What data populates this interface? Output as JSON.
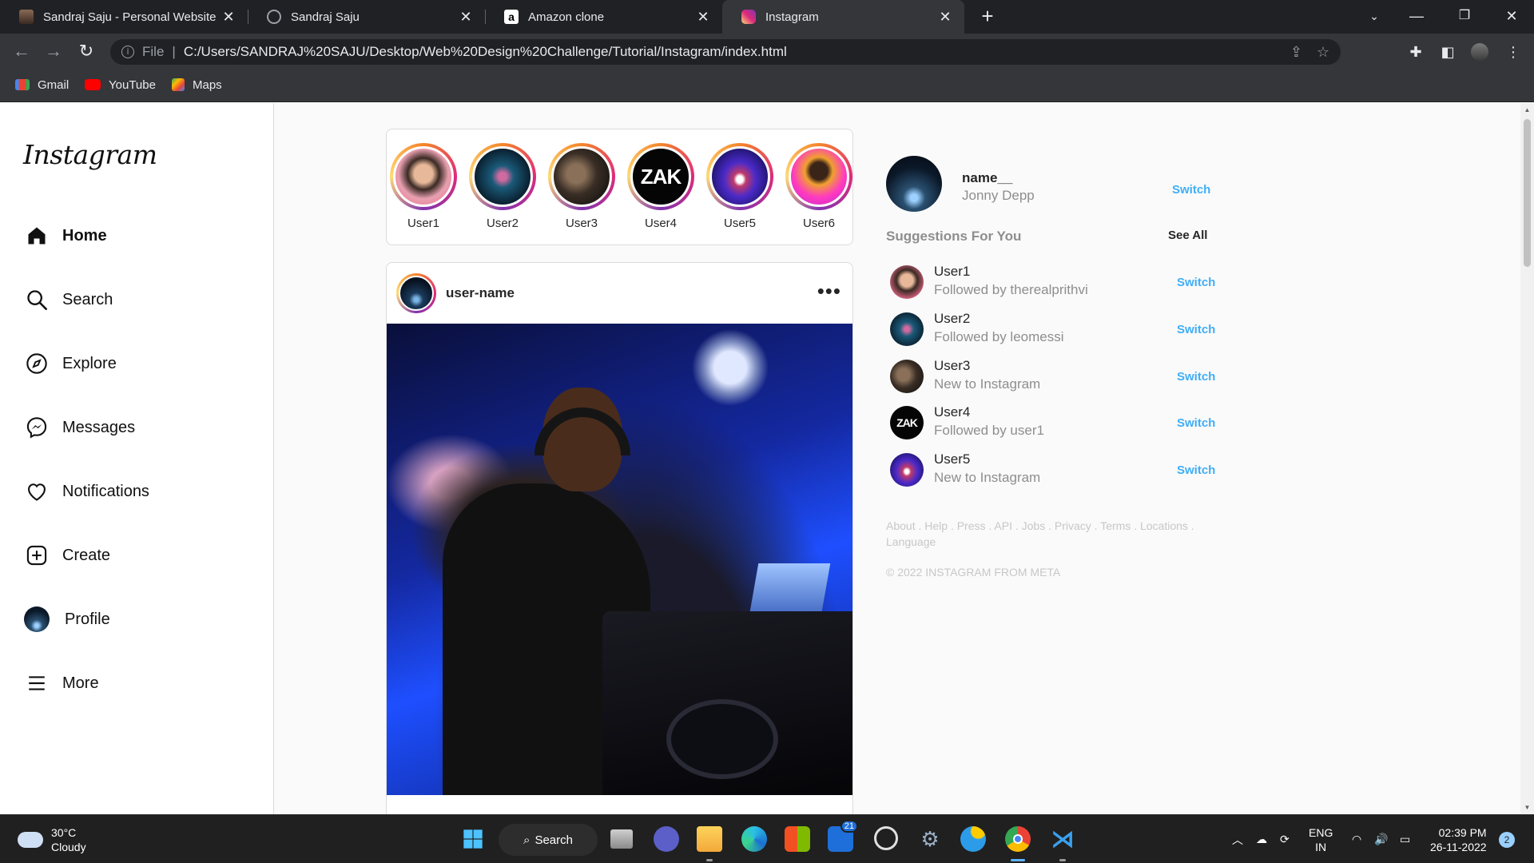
{
  "browser": {
    "tabs": [
      {
        "title": "Sandraj Saju - Personal Website",
        "active": false
      },
      {
        "title": "Sandraj Saju",
        "active": false
      },
      {
        "title": "Amazon clone",
        "active": false
      },
      {
        "title": "Instagram",
        "active": true
      }
    ],
    "address": {
      "scheme_label": "File",
      "url": "C:/Users/SANDRAJ%20SAJU/Desktop/Web%20Design%20Challenge/Tutorial/Instagram/index.html"
    },
    "bookmarks": [
      {
        "label": "Gmail",
        "icon": "gmail-icon"
      },
      {
        "label": "YouTube",
        "icon": "youtube-icon"
      },
      {
        "label": "Maps",
        "icon": "maps-icon"
      }
    ]
  },
  "sidebar": {
    "logo": "Instagram",
    "items": [
      {
        "label": "Home",
        "icon": "home-icon"
      },
      {
        "label": "Search",
        "icon": "search-icon"
      },
      {
        "label": "Explore",
        "icon": "compass-icon"
      },
      {
        "label": "Messages",
        "icon": "messenger-icon"
      },
      {
        "label": "Notifications",
        "icon": "heart-icon"
      },
      {
        "label": "Create",
        "icon": "plus-square-icon"
      },
      {
        "label": "Profile",
        "icon": "avatar"
      },
      {
        "label": "More",
        "icon": "menu-icon"
      }
    ]
  },
  "stories": [
    {
      "label": "User1"
    },
    {
      "label": "User2"
    },
    {
      "label": "User3"
    },
    {
      "label": "User4"
    },
    {
      "label": "User5"
    },
    {
      "label": "User6"
    }
  ],
  "post": {
    "username": "user-name",
    "more": "•••"
  },
  "profile": {
    "username": "name__",
    "fullname": "Jonny Depp",
    "switch_label": "Switch"
  },
  "suggestions": {
    "title": "Suggestions For You",
    "see_all": "See All",
    "items": [
      {
        "name": "User1",
        "subtitle": "Followed by therealprithvi",
        "action": "Switch"
      },
      {
        "name": "User2",
        "subtitle": "Followed by leomessi",
        "action": "Switch"
      },
      {
        "name": "User3",
        "subtitle": "New to Instagram",
        "action": "Switch"
      },
      {
        "name": "User4",
        "subtitle": "Followed by user1",
        "action": "Switch"
      },
      {
        "name": "User5",
        "subtitle": "New to Instagram",
        "action": "Switch"
      }
    ]
  },
  "footer": {
    "links": "About . Help . Press . API . Jobs . Privacy . Terms . Locations . Language",
    "copyright": "© 2022 INSTAGRAM FROM META"
  },
  "taskbar": {
    "weather_temp": "30°C",
    "weather_desc": "Cloudy",
    "search_label": "Search",
    "badge": "21",
    "lang_top": "ENG",
    "lang_bottom": "IN",
    "time": "02:39 PM",
    "date": "26-11-2022",
    "notification_count": "2"
  },
  "colors": {
    "accent": "#0095f6",
    "chrome_dark": "#202124",
    "chrome_mid": "#35363a"
  }
}
